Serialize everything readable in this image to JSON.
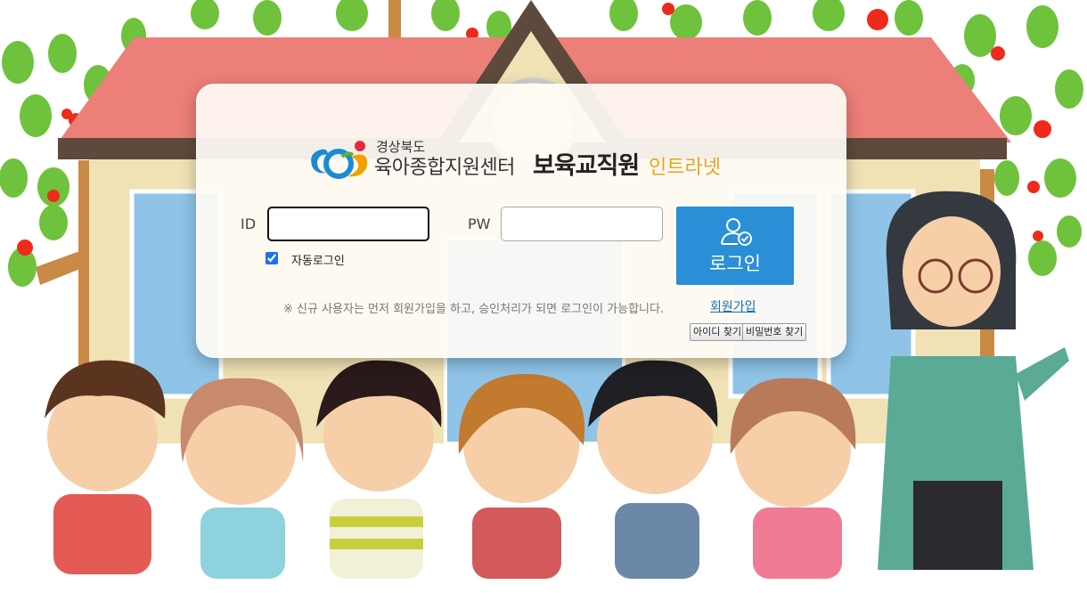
{
  "logo": {
    "region": "경상북도",
    "center": "육아종합지원센터",
    "title": "보육교직원",
    "suffix": "인트라넷"
  },
  "form": {
    "id_label": "ID",
    "pw_label": "PW",
    "id_value": "",
    "pw_value": "",
    "auto_login_label": "자동로그인",
    "auto_login_checked": true,
    "login_button": "로그인"
  },
  "notice": "※ 신규 사용자는 먼저 회원가입을 하고, 승인처리가 되면 로그인이 가능합니다.",
  "links": {
    "signup": "회원가입",
    "find_id": "아이디 찾기",
    "find_pw": "비밀번호 찾기"
  },
  "colors": {
    "login_button": "#2a8fd6",
    "intranet_text": "#f0a020",
    "roof": "#ec7f78",
    "leaf": "#6fc23c"
  },
  "icons": {
    "login_icon": "user-check-icon",
    "logo_mark": "gyeongbuk-logo-icon"
  }
}
